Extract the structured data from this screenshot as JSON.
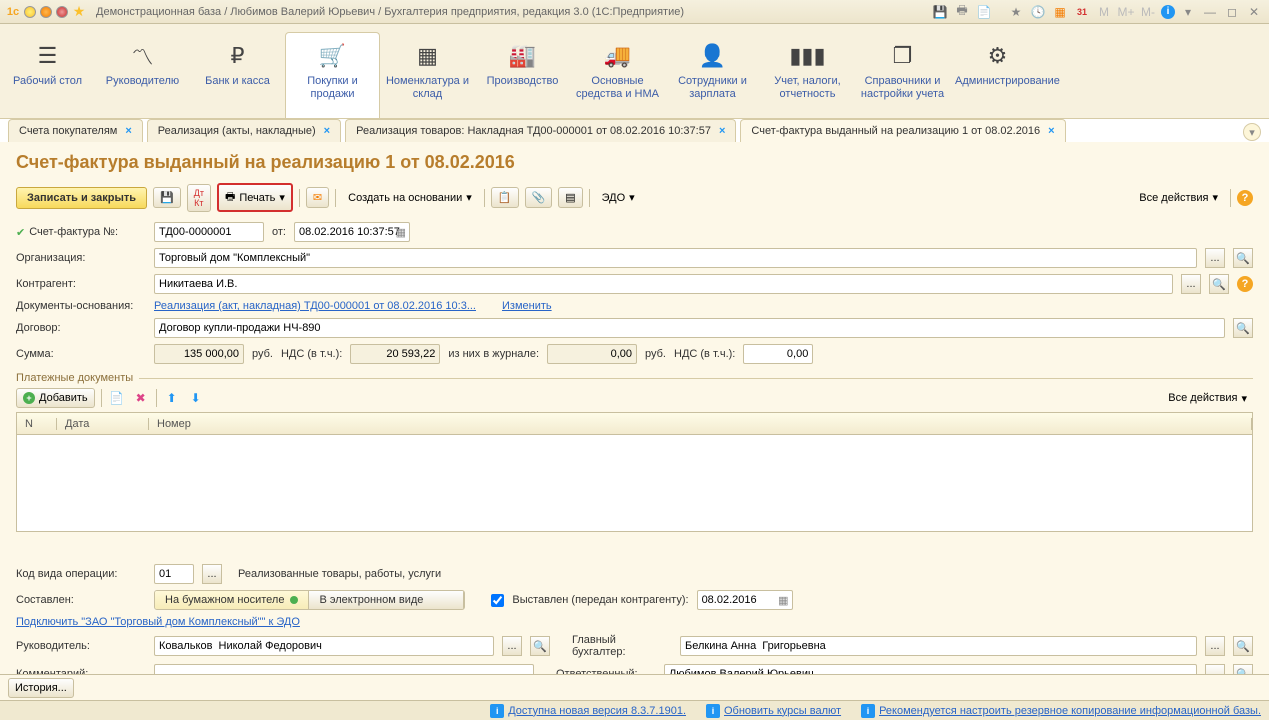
{
  "titlebar": {
    "title": "Демонстрационная база / Любимов Валерий Юрьевич / Бухгалтерия предприятия, редакция 3.0  (1С:Предприятие)",
    "right_labels": {
      "m": "M",
      "mplus": "M+",
      "mminus": "M-"
    }
  },
  "nav": [
    {
      "label": "Рабочий стол"
    },
    {
      "label": "Руководителю"
    },
    {
      "label": "Банк и касса"
    },
    {
      "label": "Покупки и продажи"
    },
    {
      "label": "Номенклатура и склад"
    },
    {
      "label": "Производство"
    },
    {
      "label": "Основные средства и НМА"
    },
    {
      "label": "Сотрудники и зарплата"
    },
    {
      "label": "Учет, налоги, отчетность"
    },
    {
      "label": "Справочники и настройки учета"
    },
    {
      "label": "Администрирование"
    }
  ],
  "tabs": [
    {
      "label": "Счета покупателям"
    },
    {
      "label": "Реализация (акты, накладные)"
    },
    {
      "label": "Реализация товаров: Накладная ТД00-000001 от 08.02.2016 10:37:57"
    },
    {
      "label": "Счет-фактура выданный на реализацию 1 от 08.02.2016"
    }
  ],
  "page": {
    "title": "Счет-фактура выданный на реализацию 1 от 08.02.2016",
    "toolbar": {
      "save_close": "Записать и закрыть",
      "print": "Печать",
      "create_based": "Создать на основании",
      "edo": "ЭДО",
      "all_actions": "Все действия"
    },
    "form": {
      "invoice_no_lbl": "Счет-фактура №:",
      "invoice_no": "ТД00-0000001",
      "from_lbl": "от:",
      "from_date": "08.02.2016 10:37:57",
      "org_lbl": "Организация:",
      "org": "Торговый дом \"Комплексный\"",
      "counterparty_lbl": "Контрагент:",
      "counterparty": "Никитаева И.В.",
      "basis_lbl": "Документы-основания:",
      "basis_link": "Реализация (акт, накладная) ТД00-000001 от 08.02.2016 10:3...",
      "change": "Изменить",
      "contract_lbl": "Договор:",
      "contract": "Договор купли-продажи НЧ-890",
      "sum_lbl": "Сумма:",
      "sum": "135 000,00",
      "rub": "руб.",
      "nds_lbl": "НДС (в т.ч.):",
      "nds": "20 593,22",
      "journal_lbl": "из них в журнале:",
      "journal_sum": "0,00",
      "journal_nds": "0,00"
    },
    "payments": {
      "title": "Платежные документы",
      "add": "Добавить",
      "all_actions": "Все действия",
      "cols": {
        "n": "N",
        "date": "Дата",
        "number": "Номер"
      }
    },
    "bottom": {
      "op_code_lbl": "Код вида операции:",
      "op_code": "01",
      "op_desc": "Реализованные товары, работы, услуги",
      "composed_lbl": "Составлен:",
      "on_paper": "На бумажном носителе",
      "electronic": "В электронном виде",
      "issued_lbl": "Выставлен (передан контрагенту):",
      "issued_date": "08.02.2016",
      "connect_link": "Подключить \"ЗАО \"Торговый дом Комплексный\"\" к ЭДО",
      "manager_lbl": "Руководитель:",
      "manager": "Ковальков  Николай Федорович",
      "accountant_lbl": "Главный бухгалтер:",
      "accountant": "Белкина Анна  Григорьевна",
      "comment_lbl": "Комментарий:",
      "responsible_lbl": "Ответственный:",
      "responsible": "Любимов Валерий Юрьевич"
    }
  },
  "history_btn": "История...",
  "statusbar": {
    "version": "Доступна новая версия 8.3.7.1901.",
    "rates": "Обновить курсы валют",
    "backup": "Рекомендуется настроить резервное копирование информационной базы."
  }
}
